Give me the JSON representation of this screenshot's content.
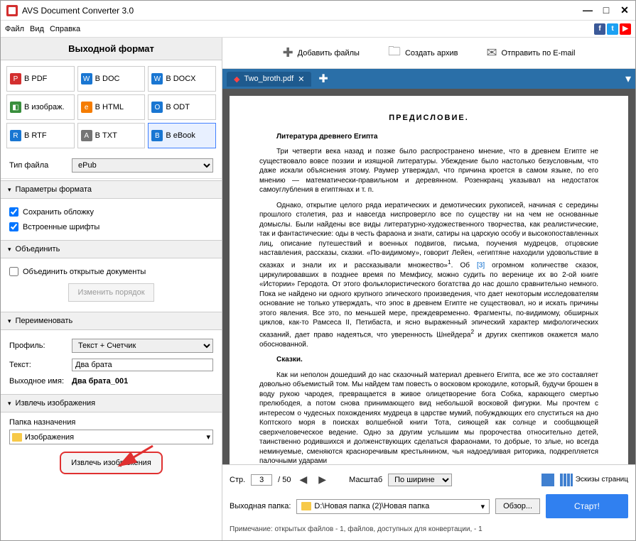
{
  "window": {
    "title": "AVS Document Converter 3.0"
  },
  "menu": {
    "file": "Файл",
    "view": "Вид",
    "help": "Справка"
  },
  "left": {
    "header": "Выходной формат",
    "formats": {
      "pdf": "В PDF",
      "doc": "В DOC",
      "docx": "В DOCX",
      "img": "В изображ.",
      "html": "В HTML",
      "odt": "В ODT",
      "rtf": "В RTF",
      "txt": "В TXT",
      "ebook": "В eBook"
    },
    "filetype_label": "Тип файла",
    "filetype_value": "ePub",
    "section_format": "Параметры формата",
    "chk_cover": "Сохранить обложку",
    "chk_fonts": "Встроенные шрифты",
    "section_merge": "Объединить",
    "chk_merge": "Объединить открытые документы",
    "btn_order": "Изменить порядок",
    "section_rename": "Переименовать",
    "profile_label": "Профиль:",
    "profile_value": "Текст + Счетчик",
    "text_label": "Текст:",
    "text_value": "Два брата",
    "outname_label": "Выходное имя:",
    "outname_value": "Два брата_001",
    "section_extract": "Извлечь изображения",
    "dest_label": "Папка назначения",
    "dest_value": "Изображения",
    "btn_extract": "Извлечь изображения"
  },
  "top_actions": {
    "add": "Добавить файлы",
    "archive": "Создать архив",
    "email": "Отправить по E-mail"
  },
  "tab": {
    "name": "Two_broth.pdf"
  },
  "preview": {
    "title": "ПРЕДИСЛОВИЕ.",
    "h1": "Литература древнего Египта",
    "p1": "Три четверти века назад и позже было распространено мнение, что в древнем Египте не существовало вовсе поэзии и изящной литературы. Убеждение было настолько безусловным, что даже искали объяснения этому. Раумер утверждал, что причина кроется в самом языке, по его мнению — математически-правильном и деревянном. Розенкранц указывал на недостаток самоуглубления в египтянах и т. п.",
    "p2a": "Однако, открытие целого ряда иератических и демотических рукописей, начиная с середины прошлого столетия, раз и навсегда ниспровергло все по существу ни на чем не основанные домыслы. Были найдены все виды литературно-художественного творчества, как реалистические, так и фантастические: оды в честь фараона и знати, сатиры на царскую особу и высокопоставленных лиц, описание путешествий и военных подвигов, письма, поучения мудрецов, отцовские наставления, рассказы, сказки. «По-видимому», говорит Лейен, «египтяне находили удовольствие в сказках и знали их и рассказывали множество»",
    "p2b": ". Об ",
    "p2link": "[3]",
    "p2c": " огромном количестве сказок, циркулировавших в позднее время по Мемфису, можно судить по веренице их во 2-ой книге «Истории» Геродота. От этого фольклористического богатства до нас дошло сравнительно немного. Пока не найдено ни одного крупного эпического произведения, что дает некоторым исследователям основание не только утверждать, что эпос в древнем Египте не существовал, но и искать причины этого явления. Все это, по меньшей мере, преждевременно. Фрагменты, по-видимому, обширных циклов, как-то Рамсеса II, Петибаста, и ясно выраженный эпический характер мифологических сказаний, дает право надеяться, что уверенность Шнейдера",
    "p2d": " и других скептиков окажется мало обоснованной.",
    "h2": "Сказки.",
    "p3": "Как ни неполон дошедший до нас сказочный материал древнего Египта, все же это составляет довольно объемистый том. Мы найдем там повесть о восковом крокодиле, который, будучи брошен в воду рукою чародея, превращается в живое олицетворение бога Собка, карающего смертью прелюбодея, а потом снова принимающего вид небольшой восковой фигурки. Мы прочтем с интересом о чудесных похождениях мудреца в царстве мумий, побуждающих его спуститься на дно Коптского моря в поисках волшебной книги Тота, сияющей как солнце и сообщающей сверхчеловеческое ведение. Одно за другим услышим мы пророчества относительно детей, таинственно родившихся и долженствующих сделаться фараонами, то добрые, то злые, но всегда неминуемые, сменяются красноречивым крестьянином, чья надоедливая риторика, подкрепляется палочными ударами"
  },
  "nav": {
    "page_label": "Стр.",
    "page_current": "3",
    "page_total": "/ 50",
    "scale_label": "Масштаб",
    "scale_value": "По ширине",
    "thumbs": "Эскизы страниц"
  },
  "output": {
    "label": "Выходная папка:",
    "path": "D:\\Новая папка (2)\\Новая папка",
    "browse": "Обзор...",
    "start": "Старт!"
  },
  "note": "Примечание: открытых файлов - 1, файлов, доступных для конвертации, - 1"
}
